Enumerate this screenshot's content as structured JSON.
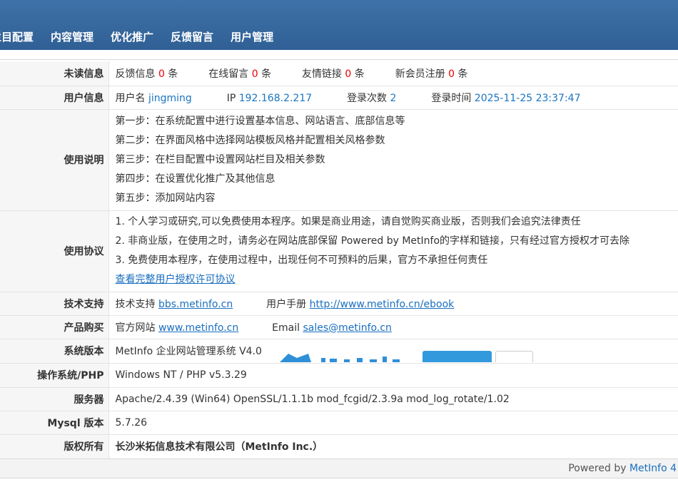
{
  "nav": [
    "栏目配置",
    "内容管理",
    "优化推广",
    "反馈留言",
    "用户管理"
  ],
  "unread": {
    "label": "未读信息",
    "items": [
      {
        "name": "反馈信息",
        "count": "0",
        "unit": "条"
      },
      {
        "name": "在线留言",
        "count": "0",
        "unit": "条"
      },
      {
        "name": "友情链接",
        "count": "0",
        "unit": "条"
      },
      {
        "name": "新会员注册",
        "count": "0",
        "unit": "条"
      }
    ]
  },
  "user": {
    "label": "用户信息",
    "username_label": "用户名",
    "username": "jingming",
    "ip_label": "IP",
    "ip": "192.168.2.217",
    "logins_label": "登录次数",
    "logins": "2",
    "last_login_label": "登录时间",
    "last_login": "2025-11-25 23:37:47"
  },
  "instructions": {
    "label": "使用说明",
    "steps": [
      "第一步：在系统配置中进行设置基本信息、网站语言、底部信息等",
      "第二步：在界面风格中选择网站模板风格并配置相关风格参数",
      "第三步：在栏目配置中设置网站栏目及相关参数",
      "第四步：在设置优化推广及其他信息",
      "第五步：添加网站内容"
    ]
  },
  "agreement": {
    "label": "使用协议",
    "lines": [
      "1. 个人学习或研究,可以免费使用本程序。如果是商业用途，请自觉购买商业版，否则我们会追究法律责任",
      "2. 非商业版，在使用之时，请务必在网站底部保留 Powered by MetInfo的字样和链接，只有经过官方授权才可去除",
      "3. 免费使用本程序，在使用过程中，出现任何不可预料的后果，官方不承担任何责任"
    ],
    "link": "查看完整用户授权许可协议"
  },
  "support": {
    "label": "技术支持",
    "forum_label": "技术支持",
    "forum": "bbs.metinfo.cn",
    "manual_label": "用户手册",
    "manual": "http://www.metinfo.cn/ebook"
  },
  "purchase": {
    "label": "产品购买",
    "site_label": "官方网站",
    "site": "www.metinfo.cn",
    "email_label": "Email",
    "email": "sales@metinfo.cn"
  },
  "version": {
    "label": "系统版本",
    "value": "MetInfo 企业网站管理系统 V4.0"
  },
  "os": {
    "label": "操作系统/PHP",
    "value": "Windows NT / PHP v5.3.29"
  },
  "server": {
    "label": "服务器",
    "value": "Apache/2.4.39 (Win64) OpenSSL/1.1.1b mod_fcgid/2.3.9a mod_log_rotate/1.02"
  },
  "mysql": {
    "label": "Mysql 版本",
    "value": "5.7.26"
  },
  "copyright": {
    "label": "版权所有",
    "value": "长沙米拓信息技术有限公司（MetInfo Inc.）"
  },
  "footer": {
    "prefix": "Powered by",
    "brand": "MetInfo 4"
  },
  "colors": {
    "header": "#3a6ca3",
    "link": "#1a6fbf",
    "count": "#ee0000"
  }
}
